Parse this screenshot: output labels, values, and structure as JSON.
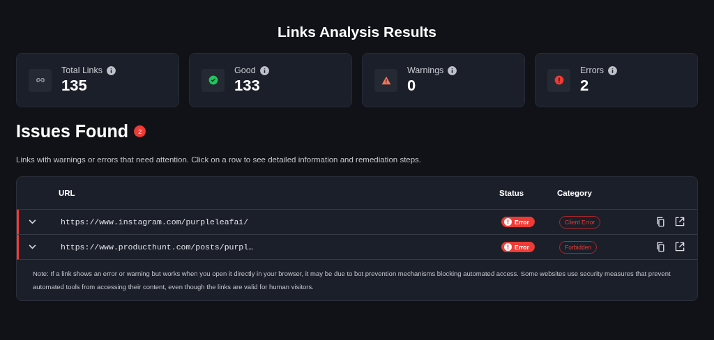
{
  "title": "Links Analysis Results",
  "stats": [
    {
      "kind": "link",
      "label": "Total Links",
      "value": "135"
    },
    {
      "kind": "good",
      "label": "Good",
      "value": "133"
    },
    {
      "kind": "warning",
      "label": "Warnings",
      "value": "0"
    },
    {
      "kind": "error",
      "label": "Errors",
      "value": "2"
    }
  ],
  "issues": {
    "heading": "Issues Found",
    "count": "2",
    "description": "Links with warnings or errors that need attention. Click on a row to see detailed information and remediation steps.",
    "table": {
      "columns": [
        "URL",
        "Status",
        "Category"
      ],
      "rows": [
        {
          "expanded": false,
          "url": "https://www.instagram.com/purpleleafai/",
          "status": {
            "kind": "error",
            "label": "Error"
          },
          "category": "Client Error"
        },
        {
          "expanded": false,
          "url": "https://www.producthunt.com/posts/purpl…",
          "status": {
            "kind": "error",
            "label": "Error"
          },
          "category": "Forbidden"
        }
      ]
    },
    "note": "Note: If a link shows an error or warning but works when you open it directly in your browser, it may be due to bot prevention mechanisms blocking automated access. Some websites use security measures that prevent automated tools from accessing their content, even though the links are valid for human visitors."
  }
}
